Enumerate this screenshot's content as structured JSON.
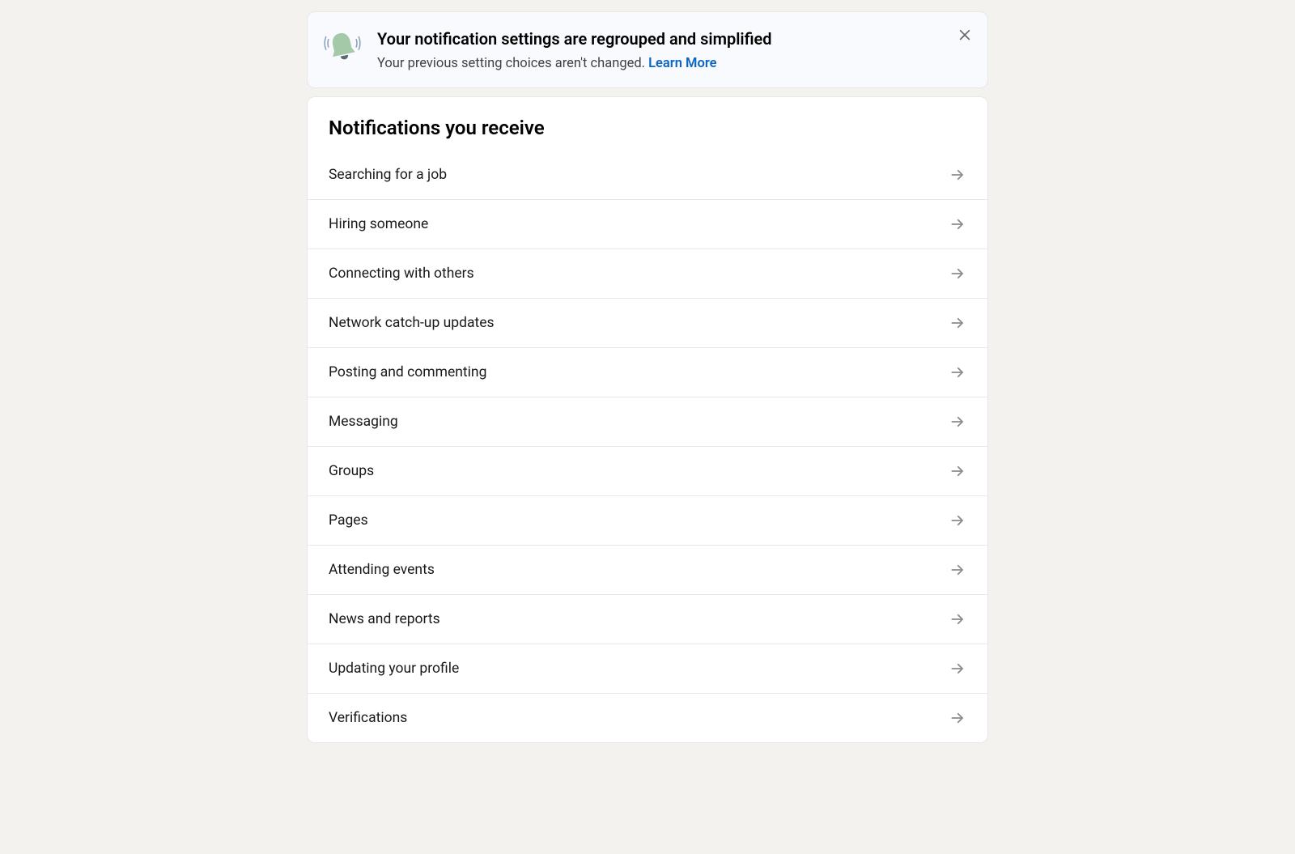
{
  "banner": {
    "title": "Your notification settings are regrouped and simplified",
    "subtitle": "Your previous setting choices aren't changed. ",
    "link_label": "Learn More"
  },
  "card": {
    "title": "Notifications you receive",
    "items": [
      {
        "label": "Searching for a job"
      },
      {
        "label": "Hiring someone"
      },
      {
        "label": "Connecting with others"
      },
      {
        "label": "Network catch-up updates"
      },
      {
        "label": "Posting and commenting"
      },
      {
        "label": "Messaging"
      },
      {
        "label": "Groups"
      },
      {
        "label": "Pages"
      },
      {
        "label": "Attending events"
      },
      {
        "label": "News and reports"
      },
      {
        "label": "Updating your profile"
      },
      {
        "label": "Verifications"
      }
    ]
  }
}
